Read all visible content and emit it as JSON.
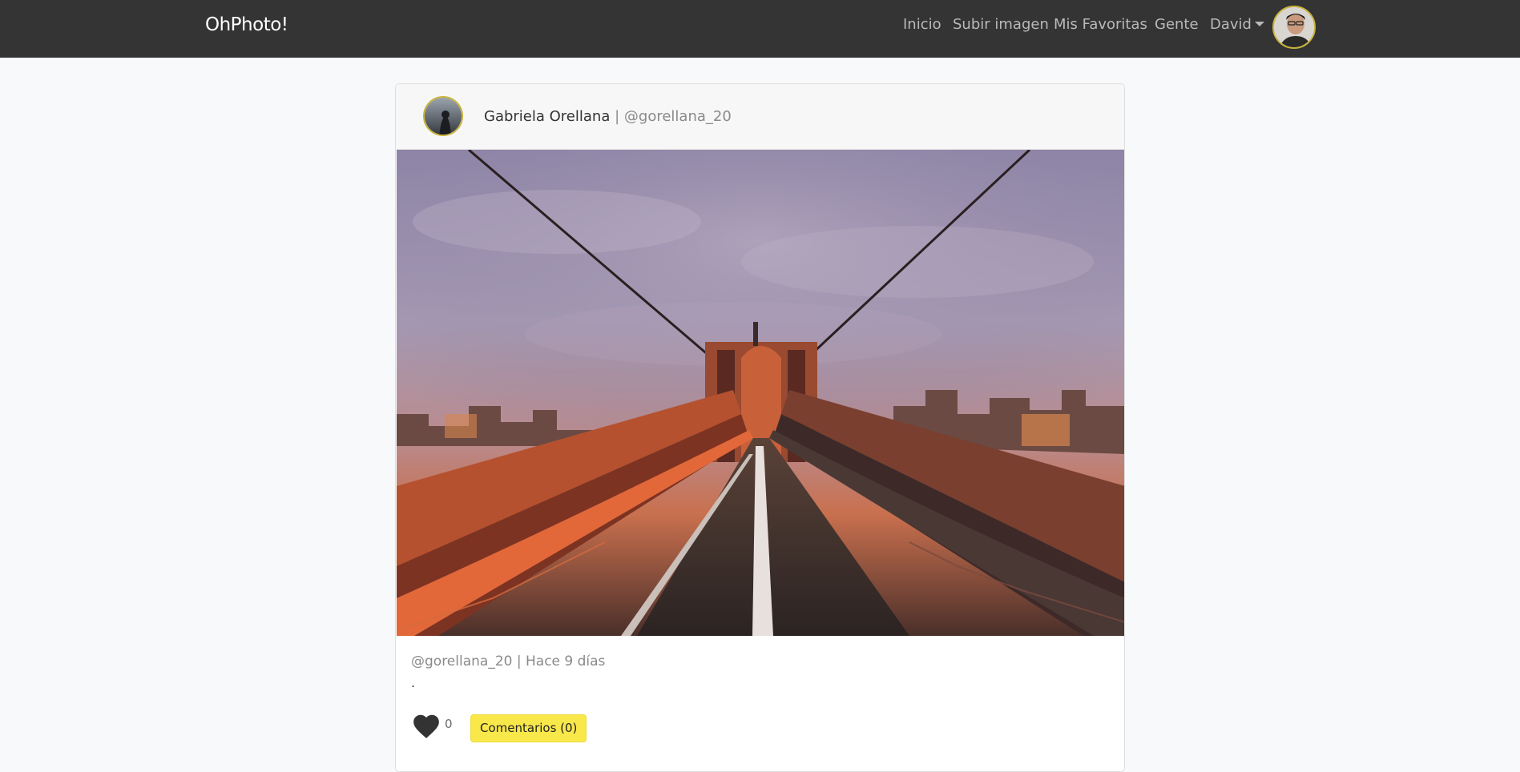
{
  "navbar": {
    "brand": "OhPhoto!",
    "links": [
      "Inicio",
      "Subir imagen",
      "Mis Favoritas",
      "Gente"
    ],
    "user_menu": "David"
  },
  "post": {
    "author_name": "Gabriela Orellana",
    "separator": "|",
    "author_handle": "@gorellana_20",
    "meta": "@gorellana_20 | Hace 9 días",
    "description": ".",
    "likes": "0",
    "comments_label": "Comentarios (0)"
  },
  "colors": {
    "navbar_bg": "#343434",
    "comments_button": "#f9e84a",
    "avatar_border": "#c9b33a"
  },
  "icons": [
    "heart-icon",
    "caret-down-icon"
  ]
}
